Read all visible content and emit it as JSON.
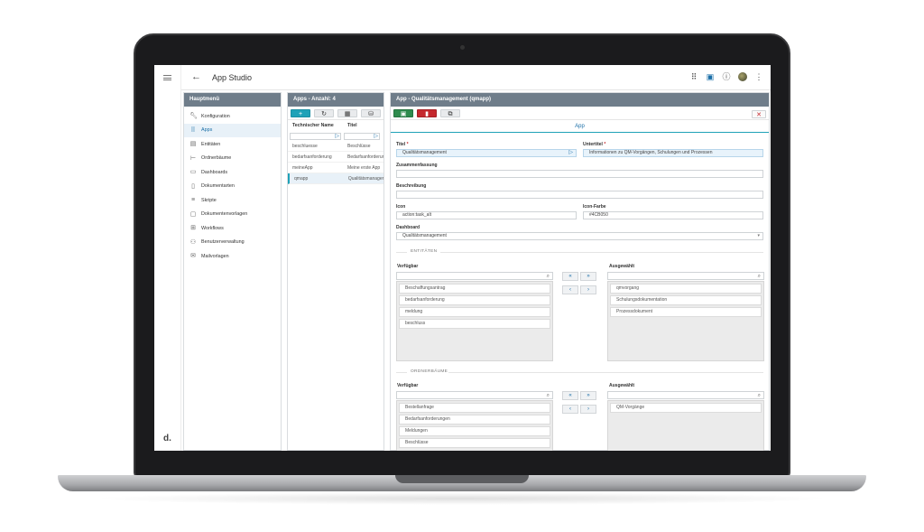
{
  "app": {
    "title": "App Studio",
    "brand": "d."
  },
  "topbar_icons": [
    "apps-grid-icon",
    "gift-icon",
    "help-icon",
    "avatar",
    "more-vert-icon"
  ],
  "main_menu": {
    "header": "Hauptmenü",
    "items": [
      {
        "label": "Konfiguration",
        "icon": "wrench-icon"
      },
      {
        "label": "Apps",
        "icon": "apps-icon",
        "active": true
      },
      {
        "label": "Entitäten",
        "icon": "entity-icon"
      },
      {
        "label": "Ordnerbäume",
        "icon": "folder-tree-icon"
      },
      {
        "label": "Dashboards",
        "icon": "dashboard-icon"
      },
      {
        "label": "Dokumentarten",
        "icon": "document-icon"
      },
      {
        "label": "Skripte",
        "icon": "script-icon"
      },
      {
        "label": "Dokumentenvorlagen",
        "icon": "template-icon"
      },
      {
        "label": "Workflows",
        "icon": "workflow-icon"
      },
      {
        "label": "Benutzerverwaltung",
        "icon": "users-icon"
      },
      {
        "label": "Mailvorlagen",
        "icon": "mail-icon"
      }
    ]
  },
  "apps_list": {
    "header": "Apps - Anzahl: 4",
    "columns": [
      "Technischer Name",
      "Titel"
    ],
    "rows": [
      {
        "name": "beschluesse",
        "title": "Beschlüsse"
      },
      {
        "name": "bedarfsanforderung",
        "title": "Bedarfsanforderung"
      },
      {
        "name": "meineApp",
        "title": "Meine erste App"
      },
      {
        "name": "qmapp",
        "title": "Qualitätsmanagement",
        "selected": true
      }
    ]
  },
  "detail": {
    "header": "App - Qualitätsmanagement (qmapp)",
    "tab": "App",
    "fields": {
      "titel_label": "Titel",
      "titel_value": "Qualitätsmanagement",
      "untertitel_label": "Untertitel",
      "untertitel_value": "Informationen zu QM-Vorgängen, Schulungen und Prozessen",
      "zusammenfassung_label": "Zusammenfassung",
      "beschreibung_label": "Beschreibung",
      "icon_label": "Icon",
      "icon_value": "action:task_alt",
      "iconfarbe_label": "Icon-Farbe",
      "iconfarbe_value": "#4CB050",
      "dashboard_label": "Dashboard",
      "dashboard_value": "Qualitätsmanagement",
      "required_mark": "*"
    },
    "entitaeten": {
      "section": "ENTITÄTEN",
      "available_label": "Verfügbar",
      "selected_label": "Ausgewählt",
      "available": [
        "Beschaffungsantrag",
        "bedarfsanforderung",
        "meldung",
        "beschluss"
      ],
      "selected": [
        "qmvorgang",
        "Schulungsdokumentation",
        "Prozessdokument"
      ]
    },
    "ordnerbaeume": {
      "section": "ORDNERBÄUME",
      "available_label": "Verfügbar",
      "selected_label": "Ausgewählt",
      "available": [
        "Bestellanfrage",
        "Bedarfsanforderungen",
        "Meldungen",
        "Beschlüsse"
      ],
      "selected": [
        "QM-Vorgänge"
      ]
    },
    "shuttle_buttons": {
      "all_left": "«",
      "all_right": "»",
      "one_left": "‹",
      "one_right": "›"
    }
  },
  "colors": {
    "header": "#6f7d8a",
    "accent": "#1fa2b8",
    "save": "#2e8b4d",
    "delete": "#c5282d"
  }
}
